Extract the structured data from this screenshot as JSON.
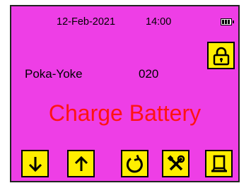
{
  "status": {
    "date": "12-Feb-2021",
    "time": "14:00",
    "battery_icon": "battery-icon"
  },
  "device": {
    "name": "Poka-Yoke",
    "code": "020"
  },
  "message": {
    "text": "Charge Battery",
    "color": "#ff1313"
  },
  "buttons": [
    {
      "icon": "arrow-down-icon"
    },
    {
      "icon": "arrow-up-icon"
    },
    {
      "icon": "refresh-icon"
    },
    {
      "icon": "tools-icon"
    },
    {
      "icon": "stand-icon"
    }
  ],
  "lock": {
    "icon": "lock-icon"
  },
  "colors": {
    "screen_bg": "#ee3ee6",
    "button_bg": "#ffee00"
  }
}
